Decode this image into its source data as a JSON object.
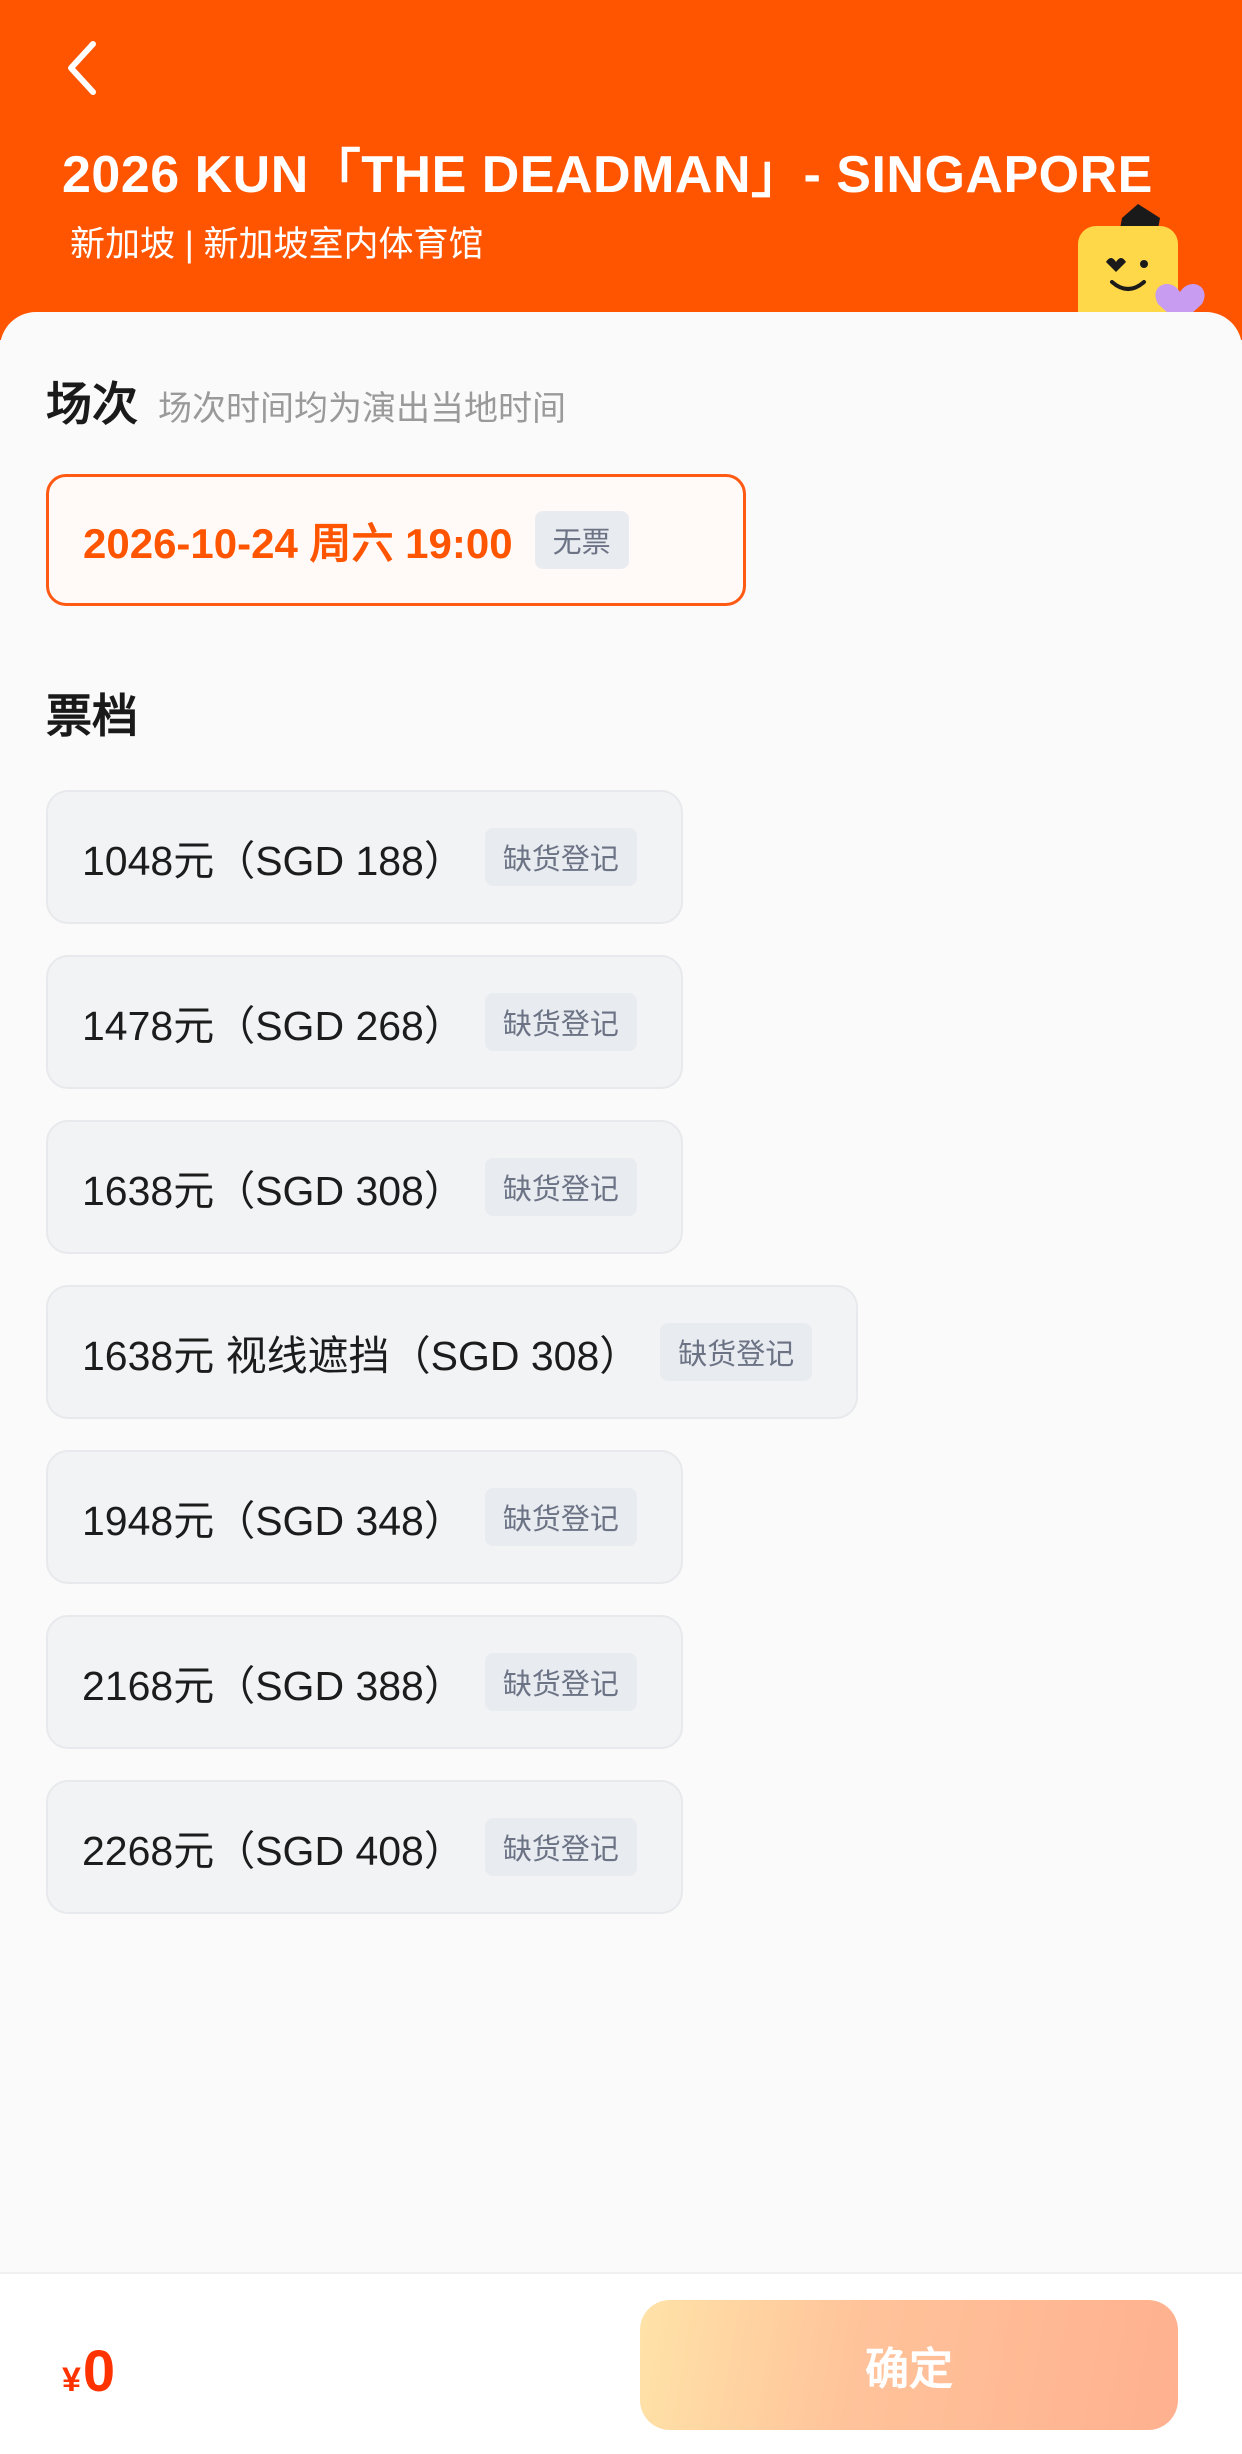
{
  "header": {
    "title": "2026 KUN「THE DEADMAN」- SINGAPORE",
    "venue": "新加坡 | 新加坡室内体育馆"
  },
  "session": {
    "title": "场次",
    "subtitle": "场次时间均为演出当地时间",
    "items": [
      {
        "date": "2026-10-24  周六 19:00",
        "status": "无票"
      }
    ]
  },
  "tiers": {
    "title": "票档",
    "items": [
      {
        "label": "1048元（SGD 188）",
        "status": "缺货登记"
      },
      {
        "label": "1478元（SGD 268）",
        "status": "缺货登记"
      },
      {
        "label": "1638元（SGD 308）",
        "status": "缺货登记"
      },
      {
        "label": "1638元 视线遮挡（SGD 308）",
        "status": "缺货登记"
      },
      {
        "label": "1948元（SGD 348）",
        "status": "缺货登记"
      },
      {
        "label": "2168元（SGD 388）",
        "status": "缺货登记"
      },
      {
        "label": "2268元（SGD 408）",
        "status": "缺货登记"
      }
    ]
  },
  "footer": {
    "currency": "¥",
    "total": "0",
    "confirm_label": "确定"
  },
  "colors": {
    "brand": "#ff5500",
    "badge_bg": "#e8ebf0",
    "badge_text": "#6b7385"
  }
}
